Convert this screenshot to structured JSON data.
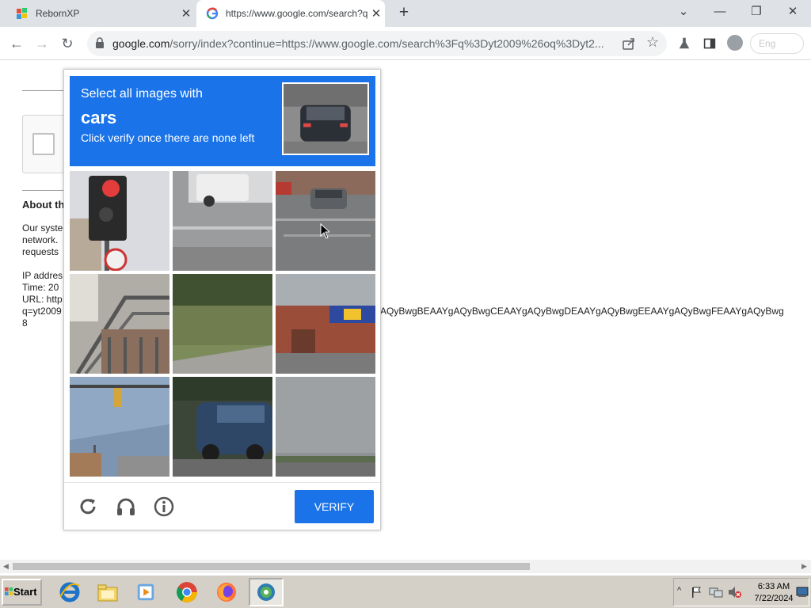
{
  "browser": {
    "tabs": [
      {
        "title": "RebornXP",
        "favicon": "windows-flag-icon"
      },
      {
        "title": "https://www.google.com/search?q",
        "favicon": "google-g-icon"
      }
    ],
    "new_tab_symbol": "+",
    "close_symbol": "✕",
    "window_controls": {
      "minimize": "—",
      "restore": "❐",
      "close": "✕",
      "dropdown": "⌄"
    },
    "address_bar": {
      "host": "google.com",
      "path": "/sorry/index?continue=https://www.google.com/search%3Fq%3Dyt2009%26oq%3Dyt2..."
    },
    "extension_pill": "Eng"
  },
  "page": {
    "about_heading": "About th",
    "body_lines": [
      "Our syste",
      "network.",
      "requests"
    ],
    "ip_line": "IP addres",
    "time_line": "Time: 20",
    "url_line": "URL: http",
    "url_line2": "q=yt2009",
    "url_line3": "8",
    "tail_text": "AQyBwgBEAAYgAQyBwgCEAAYgAQyBwgDEAAYgAQyBwgEEAAYgAQyBwgFEAAYgAQyBwg"
  },
  "captcha": {
    "instruction_line1": "Select all images with",
    "target": "cars",
    "instruction_line3": "Click verify once there are none left",
    "verify_label": "VERIFY",
    "tiles": [
      "traffic light",
      "road with van",
      "car on road",
      "stairs railing",
      "grass field",
      "storefront",
      "traffic signal",
      "blue car",
      "cloudy sky"
    ],
    "footer_icons": [
      "reload-icon",
      "audio-headphones-icon",
      "info-icon"
    ]
  },
  "taskbar": {
    "start_label": "Start",
    "apps": [
      "internet-explorer-icon",
      "file-explorer-icon",
      "media-player-icon",
      "chrome-icon",
      "firefox-icon",
      "reborn-app-icon"
    ],
    "clock_time": "6:33 AM",
    "clock_date": "7/22/2024"
  },
  "colors": {
    "accent": "#1a73e8",
    "tabstrip": "#dee1e6",
    "taskbar": "#d4d0c8"
  }
}
